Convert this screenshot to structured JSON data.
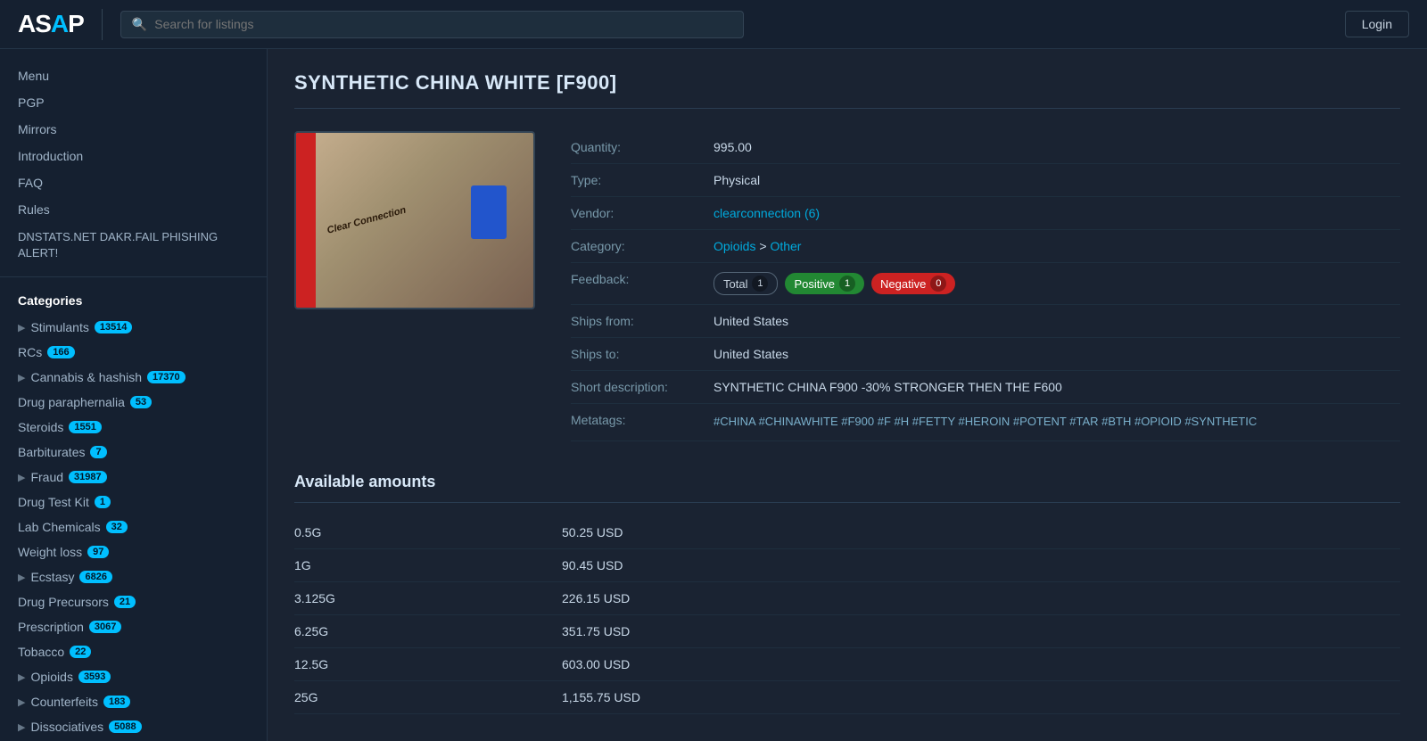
{
  "header": {
    "logo_text": "ASAP",
    "logo_dot": "·",
    "search_placeholder": "Search for listings",
    "login_label": "Login"
  },
  "sidebar": {
    "nav_items": [
      {
        "id": "menu",
        "label": "Menu"
      },
      {
        "id": "pgp",
        "label": "PGP"
      },
      {
        "id": "mirrors",
        "label": "Mirrors"
      },
      {
        "id": "introduction",
        "label": "Introduction"
      },
      {
        "id": "faq",
        "label": "FAQ"
      },
      {
        "id": "rules",
        "label": "Rules"
      },
      {
        "id": "dnstats",
        "label": "DNSTATS.NET DAKR.FAIL PHISHING ALERT!"
      }
    ],
    "categories_title": "Categories",
    "categories": [
      {
        "id": "stimulants",
        "label": "Stimulants",
        "badge": "13514",
        "has_chevron": true
      },
      {
        "id": "rcs",
        "label": "RCs",
        "badge": "166",
        "has_chevron": false
      },
      {
        "id": "cannabis",
        "label": "Cannabis & hashish",
        "badge": "17370",
        "has_chevron": true
      },
      {
        "id": "drug-paraphernalia",
        "label": "Drug paraphernalia",
        "badge": "53",
        "has_chevron": false
      },
      {
        "id": "steroids",
        "label": "Steroids",
        "badge": "1551",
        "has_chevron": false
      },
      {
        "id": "barbiturates",
        "label": "Barbiturates",
        "badge": "7",
        "has_chevron": false
      },
      {
        "id": "fraud",
        "label": "Fraud",
        "badge": "31987",
        "has_chevron": true
      },
      {
        "id": "drug-test-kit",
        "label": "Drug Test Kit",
        "badge": "1",
        "has_chevron": false
      },
      {
        "id": "lab-chemicals",
        "label": "Lab Chemicals",
        "badge": "32",
        "has_chevron": false
      },
      {
        "id": "weight-loss",
        "label": "Weight loss",
        "badge": "97",
        "has_chevron": false
      },
      {
        "id": "ecstasy",
        "label": "Ecstasy",
        "badge": "6826",
        "has_chevron": true
      },
      {
        "id": "drug-precursors",
        "label": "Drug Precursors",
        "badge": "21",
        "has_chevron": false
      },
      {
        "id": "prescription",
        "label": "Prescription",
        "badge": "3067",
        "has_chevron": false
      },
      {
        "id": "tobacco",
        "label": "Tobacco",
        "badge": "22",
        "has_chevron": false
      },
      {
        "id": "opioids",
        "label": "Opioids",
        "badge": "3593",
        "has_chevron": true
      },
      {
        "id": "counterfeits",
        "label": "Counterfeits",
        "badge": "183",
        "has_chevron": true
      },
      {
        "id": "dissociatives",
        "label": "Dissociatives",
        "badge": "5088",
        "has_chevron": true
      }
    ]
  },
  "product": {
    "title": "SYNTHETIC CHINA WHITE [F900]",
    "quantity": "995.00",
    "type": "Physical",
    "vendor": "clearconnection (6)",
    "category_parent": "Opioids",
    "category_child": "Other",
    "feedback": {
      "total_label": "Total",
      "total_count": "1",
      "positive_label": "Positive",
      "positive_count": "1",
      "negative_label": "Negative",
      "negative_count": "0"
    },
    "ships_from": "United States",
    "ships_to": "United States",
    "short_description": "SYNTHETIC CHINA F900 -30% STRONGER THEN THE F600",
    "metatags": "#CHINA #CHINAWHITE #F900 #F #H #FETTY #HEROIN #POTENT #TAR #BTH #OPIOID #SYNTHETIC"
  },
  "amounts": {
    "title": "Available amounts",
    "items": [
      {
        "qty": "0.5G",
        "price": "50.25 USD"
      },
      {
        "qty": "1G",
        "price": "90.45 USD"
      },
      {
        "qty": "3.125G",
        "price": "226.15 USD"
      },
      {
        "qty": "6.25G",
        "price": "351.75 USD"
      },
      {
        "qty": "12.5G",
        "price": "603.00 USD"
      },
      {
        "qty": "25G",
        "price": "1,155.75 USD"
      }
    ]
  },
  "labels": {
    "quantity": "Quantity:",
    "type": "Type:",
    "vendor": "Vendor:",
    "category": "Category:",
    "feedback": "Feedback:",
    "ships_from": "Ships from:",
    "ships_to": "Ships to:",
    "short_description": "Short description:",
    "metatags": "Metatags:"
  }
}
